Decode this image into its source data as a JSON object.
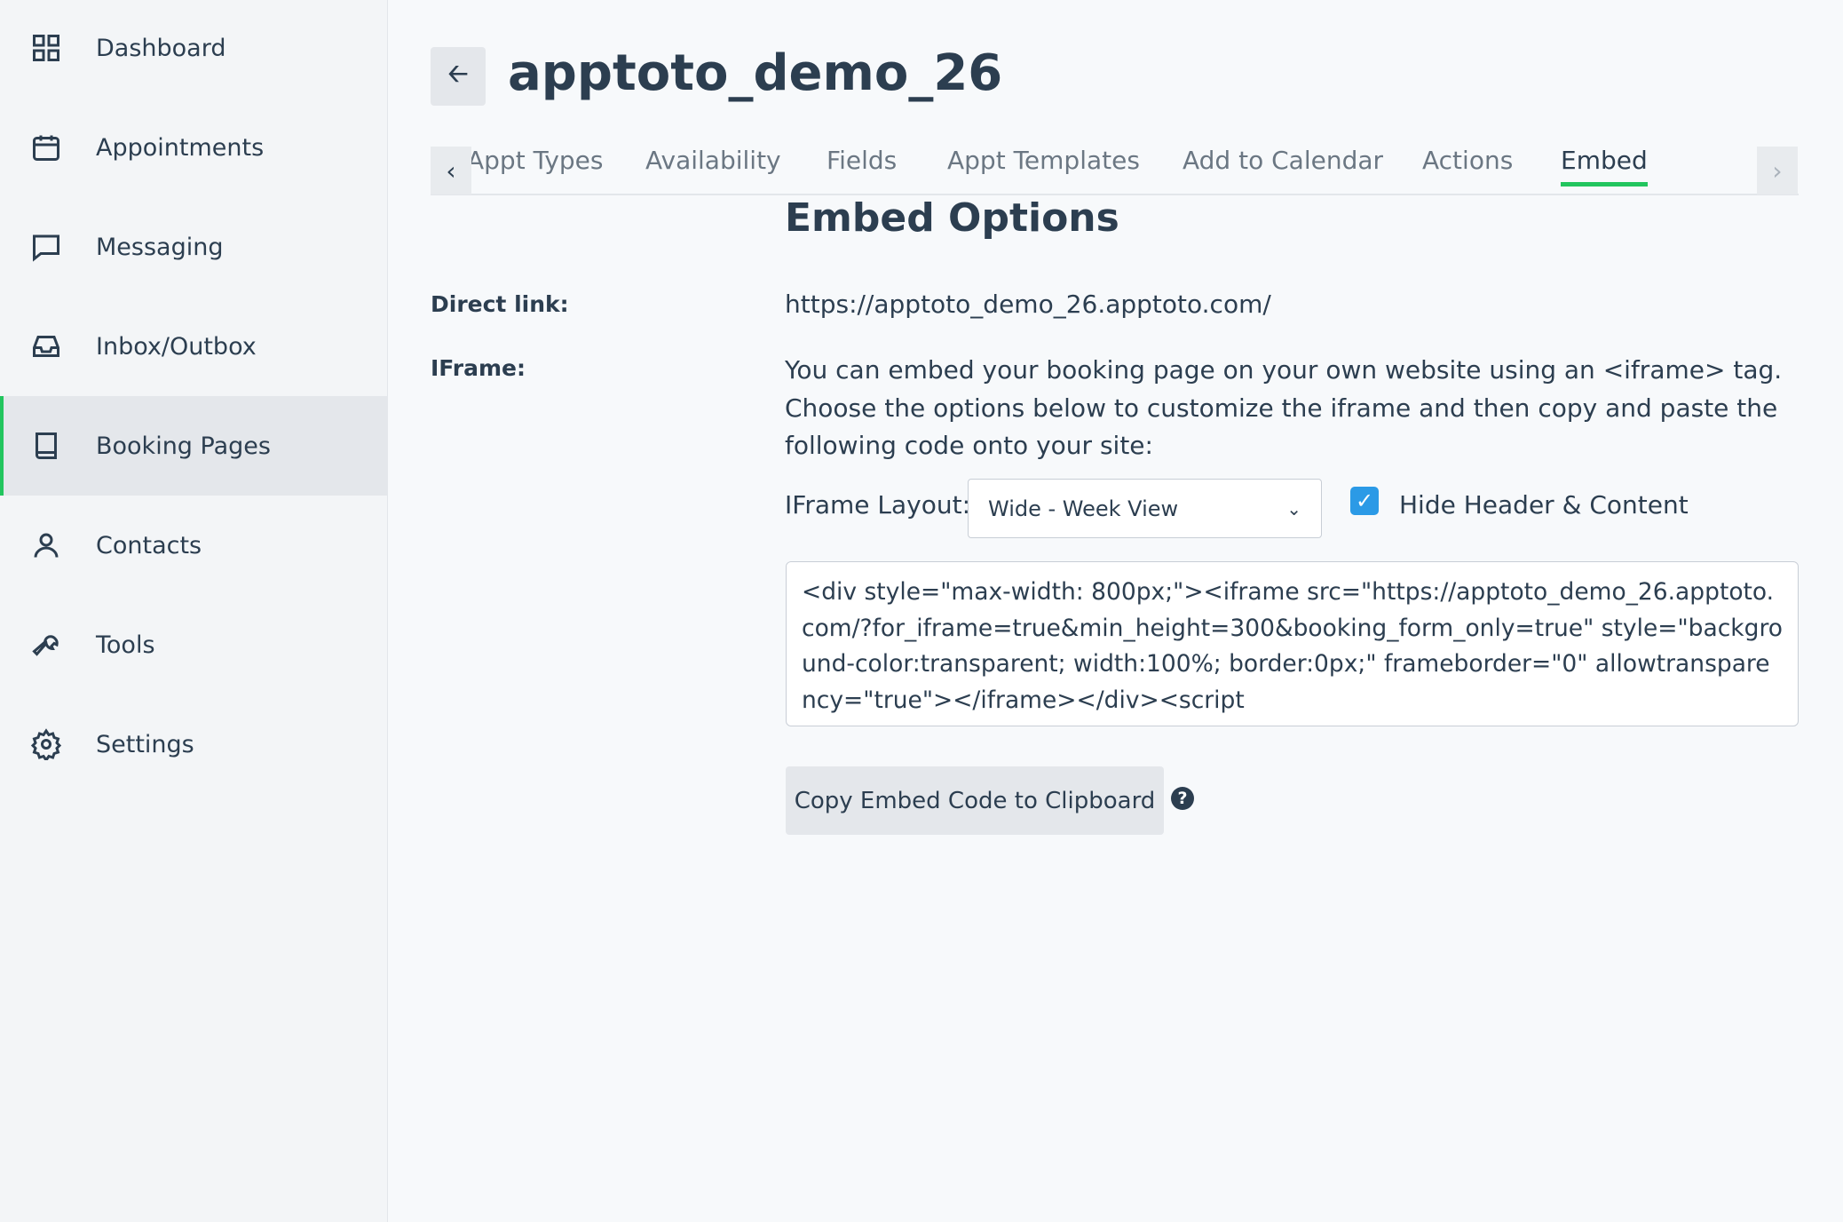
{
  "sidebar": {
    "items": [
      {
        "label": "Dashboard",
        "icon": "grid-icon"
      },
      {
        "label": "Appointments",
        "icon": "calendar-icon"
      },
      {
        "label": "Messaging",
        "icon": "chat-icon"
      },
      {
        "label": "Inbox/Outbox",
        "icon": "inbox-icon"
      },
      {
        "label": "Booking Pages",
        "icon": "book-icon",
        "active": true
      },
      {
        "label": "Contacts",
        "icon": "user-icon"
      },
      {
        "label": "Tools",
        "icon": "wrench-icon"
      },
      {
        "label": "Settings",
        "icon": "gear-icon"
      }
    ]
  },
  "header": {
    "title": "apptoto_demo_26",
    "back_icon": "arrow-left-icon"
  },
  "tabs": [
    "Appt Types",
    "Availability",
    "Fields",
    "Appt Templates",
    "Add to Calendar",
    "Actions",
    "Embed"
  ],
  "active_tab": "Embed",
  "accent": "#22c55e",
  "embed": {
    "heading": "Embed Options",
    "direct_link_label": "Direct link:",
    "direct_link": "https://apptoto_demo_26.apptoto.com/",
    "iframe_label": "IFrame:",
    "iframe_desc": "You can embed your booking page on your own website using an <iframe> tag. Choose the options below to customize the iframe and then copy and paste the following code onto your site:",
    "layout_label": "IFrame Layout:",
    "layout_value": "Wide - Week View",
    "hide_header_label": "Hide Header & Content",
    "hide_header_checked": true,
    "code": "<div style=\"max-width: 800px;\"><iframe src=\"https://apptoto_demo_26.apptoto.com/?for_iframe=true&min_height=300&booking_form_only=true\" style=\"background-color:transparent; width:100%; border:0px;\" frameborder=\"0\" allowtransparency=\"true\"></iframe></div><script",
    "copy_button": "Copy Embed Code to Clipboard"
  }
}
